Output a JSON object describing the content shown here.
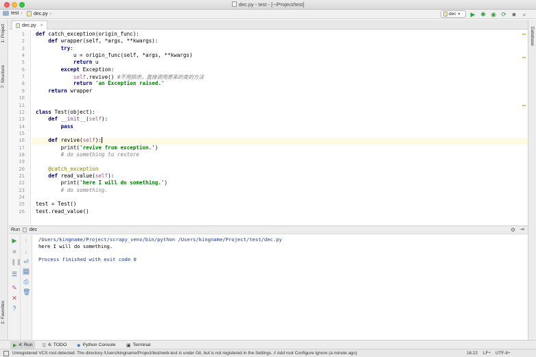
{
  "window": {
    "title": "dec.py - test - [~/Project/test]"
  },
  "navbar": {
    "breadcrumbs": [
      "test",
      "dec.py"
    ],
    "run_config": "dec"
  },
  "left_strip": {
    "project_tab": "1: Project",
    "structure_tab": "7: Structure",
    "favorites_tab": "2: Favorites"
  },
  "right_strip": {
    "database_tab": "Database"
  },
  "editor": {
    "tab_label": "dec.py",
    "current_line": 16,
    "lines": [
      [
        {
          "t": "def ",
          "c": "kw"
        },
        {
          "t": "catch_exception(origin_func):",
          "c": ""
        }
      ],
      [
        {
          "t": "    ",
          "c": ""
        },
        {
          "t": "def ",
          "c": "kw"
        },
        {
          "t": "wrapper(self, *args, **kwargs):",
          "c": ""
        }
      ],
      [
        {
          "t": "        ",
          "c": ""
        },
        {
          "t": "try",
          "c": "kw"
        },
        {
          "t": ":",
          "c": ""
        }
      ],
      [
        {
          "t": "            u = origin_func(self, *args, **kwargs)",
          "c": ""
        }
      ],
      [
        {
          "t": "            ",
          "c": ""
        },
        {
          "t": "return ",
          "c": "kw"
        },
        {
          "t": "u",
          "c": ""
        }
      ],
      [
        {
          "t": "        ",
          "c": ""
        },
        {
          "t": "except ",
          "c": "kw"
        },
        {
          "t": "Exception:",
          "c": ""
        }
      ],
      [
        {
          "t": "            ",
          "c": ""
        },
        {
          "t": "self",
          "c": "self"
        },
        {
          "t": ".revive() ",
          "c": ""
        },
        {
          "t": "#不用顾虑，直接调用原来的类的方法",
          "c": "cmt"
        }
      ],
      [
        {
          "t": "            ",
          "c": ""
        },
        {
          "t": "return ",
          "c": "kw"
        },
        {
          "t": "'an Exception raised.'",
          "c": "str"
        }
      ],
      [
        {
          "t": "    ",
          "c": ""
        },
        {
          "t": "return ",
          "c": "kw"
        },
        {
          "t": "wrapper",
          "c": ""
        }
      ],
      [],
      [],
      [
        {
          "t": "class ",
          "c": "kw"
        },
        {
          "t": "Test(object):",
          "c": ""
        }
      ],
      [
        {
          "t": "    ",
          "c": ""
        },
        {
          "t": "def ",
          "c": "kw"
        },
        {
          "t": "__init__",
          "c": "magic"
        },
        {
          "t": "(",
          "c": ""
        },
        {
          "t": "self",
          "c": "self"
        },
        {
          "t": "):",
          "c": ""
        }
      ],
      [
        {
          "t": "        ",
          "c": ""
        },
        {
          "t": "pass",
          "c": "kw"
        }
      ],
      [],
      [
        {
          "t": "    ",
          "c": ""
        },
        {
          "t": "def ",
          "c": "kw"
        },
        {
          "t": "revive(",
          "c": ""
        },
        {
          "t": "self",
          "c": "self"
        },
        {
          "t": "):",
          "c": ""
        }
      ],
      [
        {
          "t": "        print(",
          "c": ""
        },
        {
          "t": "'revive from exception.'",
          "c": "str"
        },
        {
          "t": ")",
          "c": ""
        }
      ],
      [
        {
          "t": "        ",
          "c": ""
        },
        {
          "t": "# do something to restore",
          "c": "cmt"
        }
      ],
      [],
      [
        {
          "t": "    ",
          "c": ""
        },
        {
          "t": "@catch_exception",
          "c": "dec"
        }
      ],
      [
        {
          "t": "    ",
          "c": ""
        },
        {
          "t": "def ",
          "c": "kw"
        },
        {
          "t": "read_value(",
          "c": ""
        },
        {
          "t": "self",
          "c": "self"
        },
        {
          "t": "):",
          "c": ""
        }
      ],
      [
        {
          "t": "        print(",
          "c": ""
        },
        {
          "t": "'here I will do something.'",
          "c": "str"
        },
        {
          "t": ")",
          "c": ""
        }
      ],
      [
        {
          "t": "        ",
          "c": ""
        },
        {
          "t": "# do something.",
          "c": "cmt"
        }
      ],
      [],
      [
        {
          "t": "test = Test()",
          "c": ""
        }
      ],
      [
        {
          "t": "test.read_value()",
          "c": ""
        }
      ]
    ]
  },
  "run_panel": {
    "label": "Run",
    "config": "dec",
    "output": [
      "/Users/kingname/Project/scrapy_venv/bin/python /Users/kingname/Project/test/dec.py",
      "here I will do something.",
      "",
      "Process finished with exit code 0"
    ]
  },
  "bottom_tabs": [
    "4: Run",
    "6: TODO",
    "Python Console",
    "Terminal"
  ],
  "status": {
    "message": "Unregistered VCS root detected: The directory /Users/kingname/Project/test/web-test is under Git, but is not registered in the Settings. // Add root  Configure  Ignore (a minute ago)",
    "position": "16:22",
    "line_sep": "LF÷",
    "encoding": "UTF-8÷"
  },
  "colors": {
    "accent": "#2aa63a",
    "keyword": "#000080",
    "string": "#008000",
    "comment": "#808080"
  }
}
